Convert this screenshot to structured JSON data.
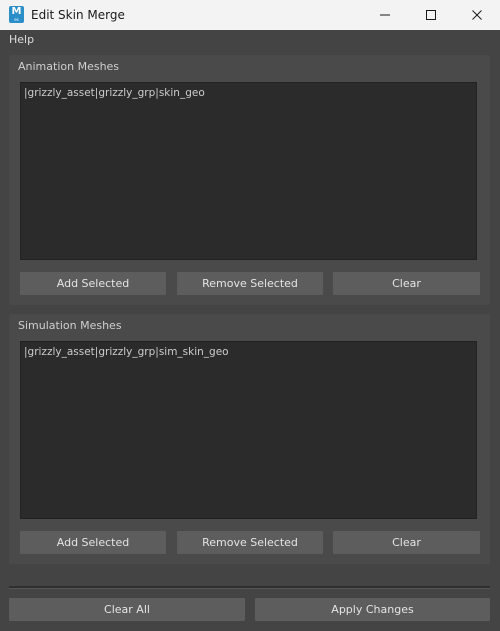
{
  "window": {
    "title": "Edit Skin Merge",
    "icon_letter": "M",
    "icon_sub": "es"
  },
  "menu": {
    "items": [
      "Help"
    ]
  },
  "animation_group": {
    "title": "Animation Meshes",
    "items": [
      "|grizzly_asset|grizzly_grp|skin_geo"
    ],
    "add_label": "Add Selected",
    "remove_label": "Remove Selected",
    "clear_label": "Clear"
  },
  "simulation_group": {
    "title": "Simulation Meshes",
    "items": [
      "|grizzly_asset|grizzly_grp|sim_skin_geo"
    ],
    "add_label": "Add Selected",
    "remove_label": "Remove Selected",
    "clear_label": "Clear"
  },
  "footer": {
    "clear_all_label": "Clear All",
    "apply_label": "Apply Changes"
  },
  "colors": {
    "window_bg": "#444444",
    "panel_bg": "#4a4a4a",
    "list_bg": "#2b2b2b",
    "button_bg": "#5d5d5d",
    "icon_blue": "#2a8ec8"
  }
}
